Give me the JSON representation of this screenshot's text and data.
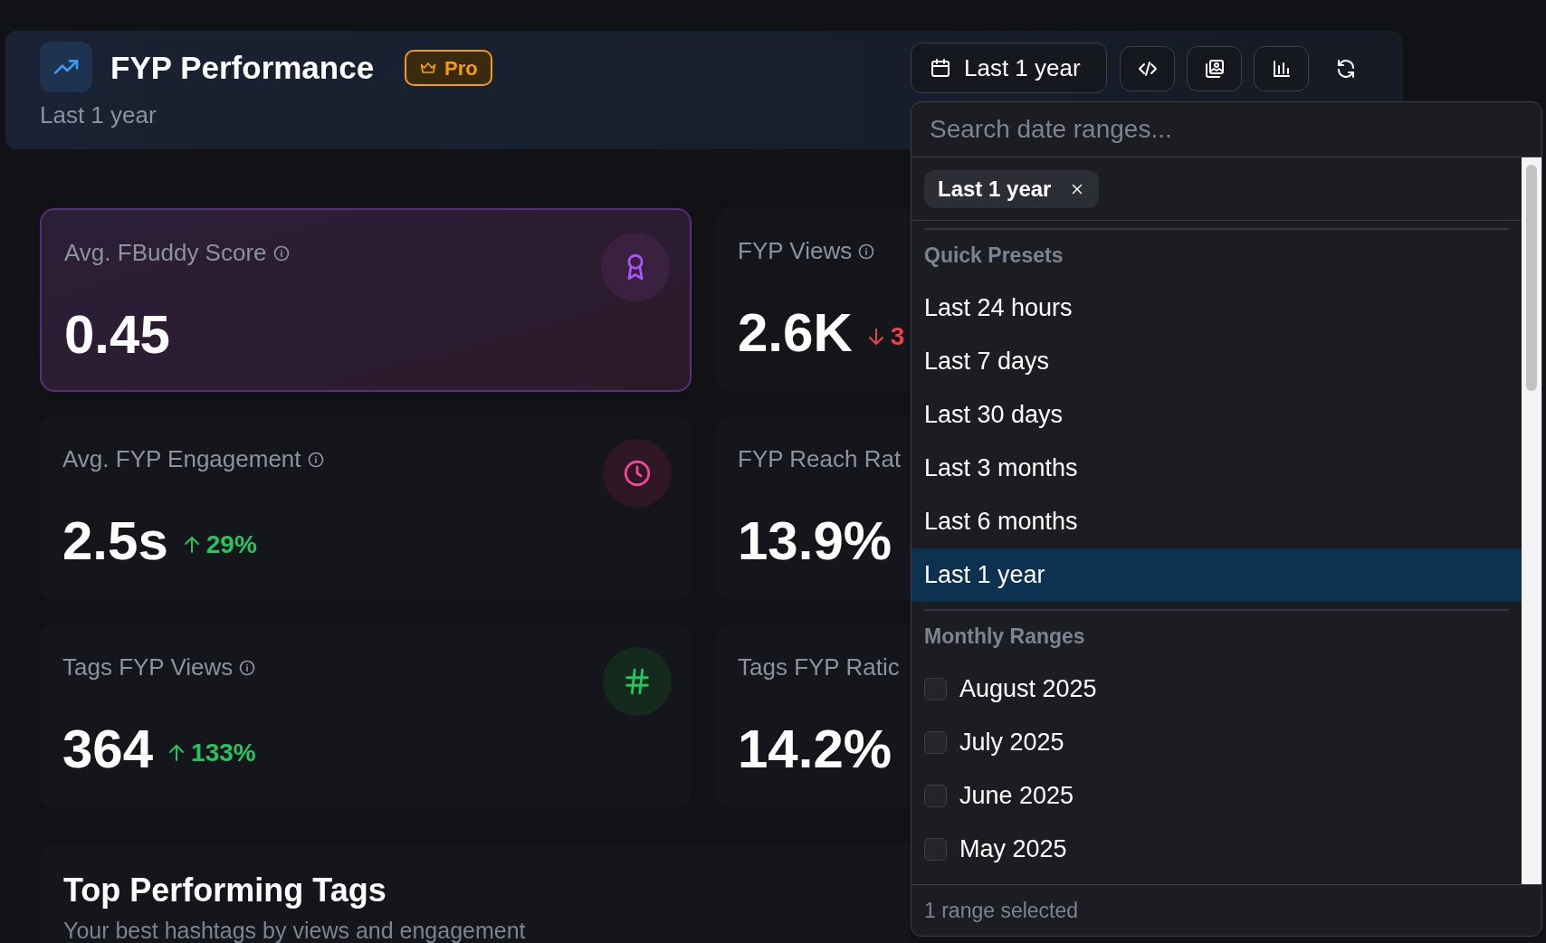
{
  "header": {
    "title": "FYP Performance",
    "badge": "Pro",
    "subtitle": "Last 1 year"
  },
  "toolbar": {
    "date_button": "Last 1 year",
    "buttons": [
      {
        "kind": "code"
      },
      {
        "kind": "image"
      },
      {
        "kind": "chart"
      },
      {
        "kind": "refresh"
      }
    ]
  },
  "metrics": [
    {
      "label": "Avg. FBuddy Score",
      "info": true,
      "value": "0.45",
      "highlighted": true
    },
    {
      "label": "FYP Views",
      "info": true,
      "value": "2.6K",
      "delta": {
        "kind": "decrease",
        "text": "3"
      },
      "highlighted": false
    },
    {
      "label": "Avg. FYP Engagement",
      "info": true,
      "value": "2.5s",
      "delta": {
        "kind": "increase",
        "text": "29%"
      },
      "highlighted": false
    },
    {
      "label": "FYP Reach Rat",
      "info": false,
      "value": "13.9%",
      "highlighted": false
    },
    {
      "label": "Tags FYP Views",
      "info": true,
      "value": "364",
      "delta": {
        "kind": "increase",
        "text": "133%"
      },
      "highlighted": false
    },
    {
      "label": "Tags FYP Ratic",
      "info": false,
      "value": "14.2%",
      "highlighted": false
    }
  ],
  "dropdown": {
    "search": {
      "placeholder": "Search date ranges..."
    },
    "chips": [
      {
        "label": "Last 1 year"
      }
    ],
    "sections": [
      {
        "title": "Quick Presets",
        "kind": "preset",
        "items": [
          {
            "label": "Last 24 hours",
            "selected": false
          },
          {
            "label": "Last 7 days",
            "selected": false
          },
          {
            "label": "Last 30 days",
            "selected": false
          },
          {
            "label": "Last 3 months",
            "selected": false
          },
          {
            "label": "Last 6 months",
            "selected": false
          },
          {
            "label": "Last 1 year",
            "selected": true
          }
        ]
      },
      {
        "title": "Monthly Ranges",
        "kind": "checkbox",
        "items": [
          {
            "label": "August 2025",
            "checked": false
          },
          {
            "label": "July 2025",
            "checked": false
          },
          {
            "label": "June 2025",
            "checked": false
          },
          {
            "label": "May 2025",
            "checked": false
          }
        ]
      }
    ],
    "footer": "1 range selected"
  },
  "top_tags": {
    "title": "Top Performing Tags",
    "subtitle": "Your best hashtags by views and engagement"
  }
}
